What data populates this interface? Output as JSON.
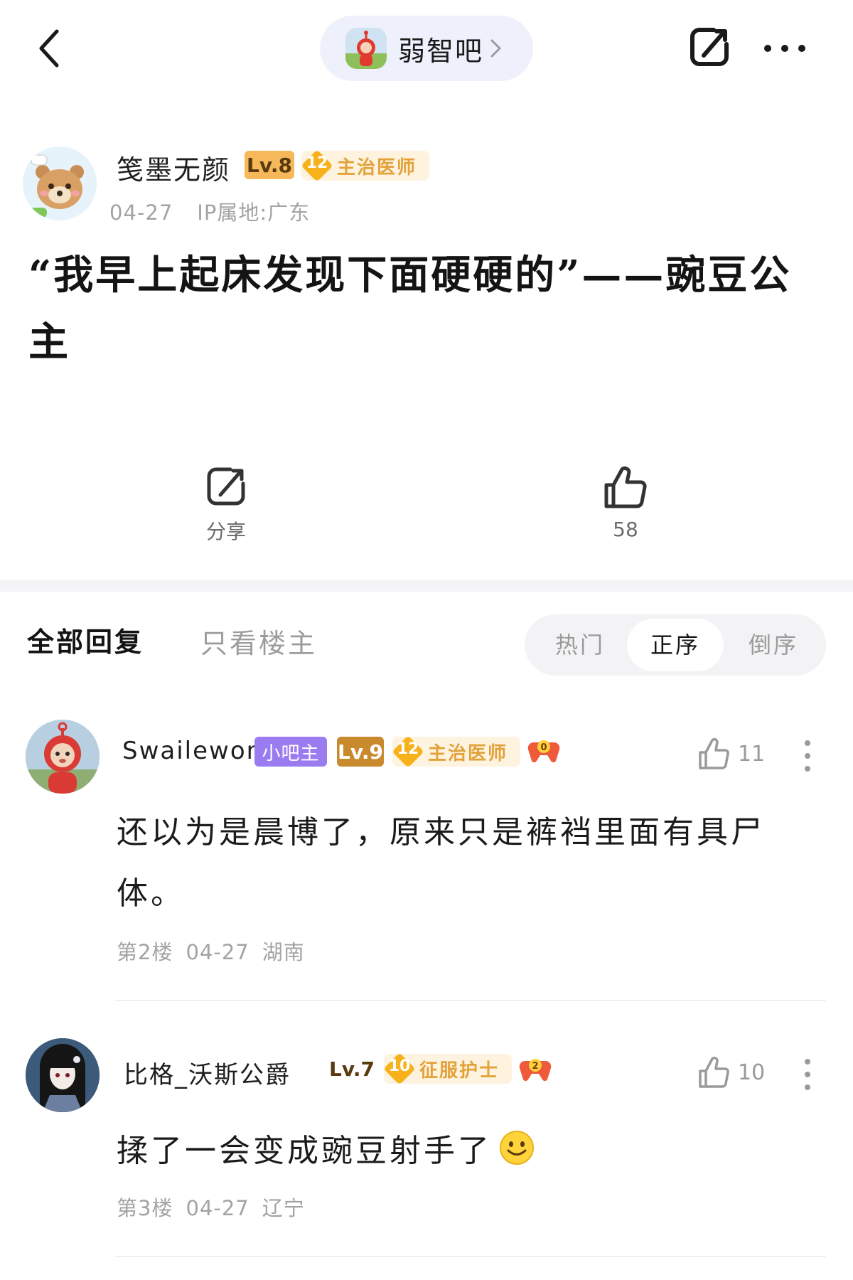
{
  "nav": {
    "forum_name": "弱智吧"
  },
  "post": {
    "author": "笺墨无颜",
    "level": "Lv.8",
    "rank_num": "12",
    "rank_title": "主治医师",
    "date": "04-27",
    "ip": "IP属地:广东",
    "title": "“我早上起床发现下面硬硬的”——豌豆公主",
    "share_label": "分享",
    "like_count": "58"
  },
  "replies": {
    "tab_all": "全部回复",
    "tab_op": "只看楼主",
    "sort_hot": "热门",
    "sort_asc": "正序",
    "sort_desc": "倒序"
  },
  "comments": [
    {
      "name": "Swailewon",
      "owner_badge": "小吧主",
      "level": "Lv.9",
      "rank_num": "12",
      "rank_title": "主治医师",
      "game_badge": "0",
      "likes": "11",
      "body": "还以为是晨博了，原来只是裤裆里面有具尸体。",
      "floor": "第2楼",
      "date": "04-27",
      "location": "湖南"
    },
    {
      "name": "比格_沃斯公爵",
      "level": "Lv.7",
      "rank_num": "10",
      "rank_title": "征服护士",
      "game_badge": "2",
      "likes": "10",
      "body": "揉了一会变成豌豆射手了",
      "floor": "第3楼",
      "date": "04-27",
      "location": "辽宁"
    }
  ],
  "colors": {
    "owner_badge": "#9b7cf0",
    "level_badge": "#f6b85a",
    "rank_gold": "#f7b21b",
    "pill_bg": "#eef1fb"
  }
}
